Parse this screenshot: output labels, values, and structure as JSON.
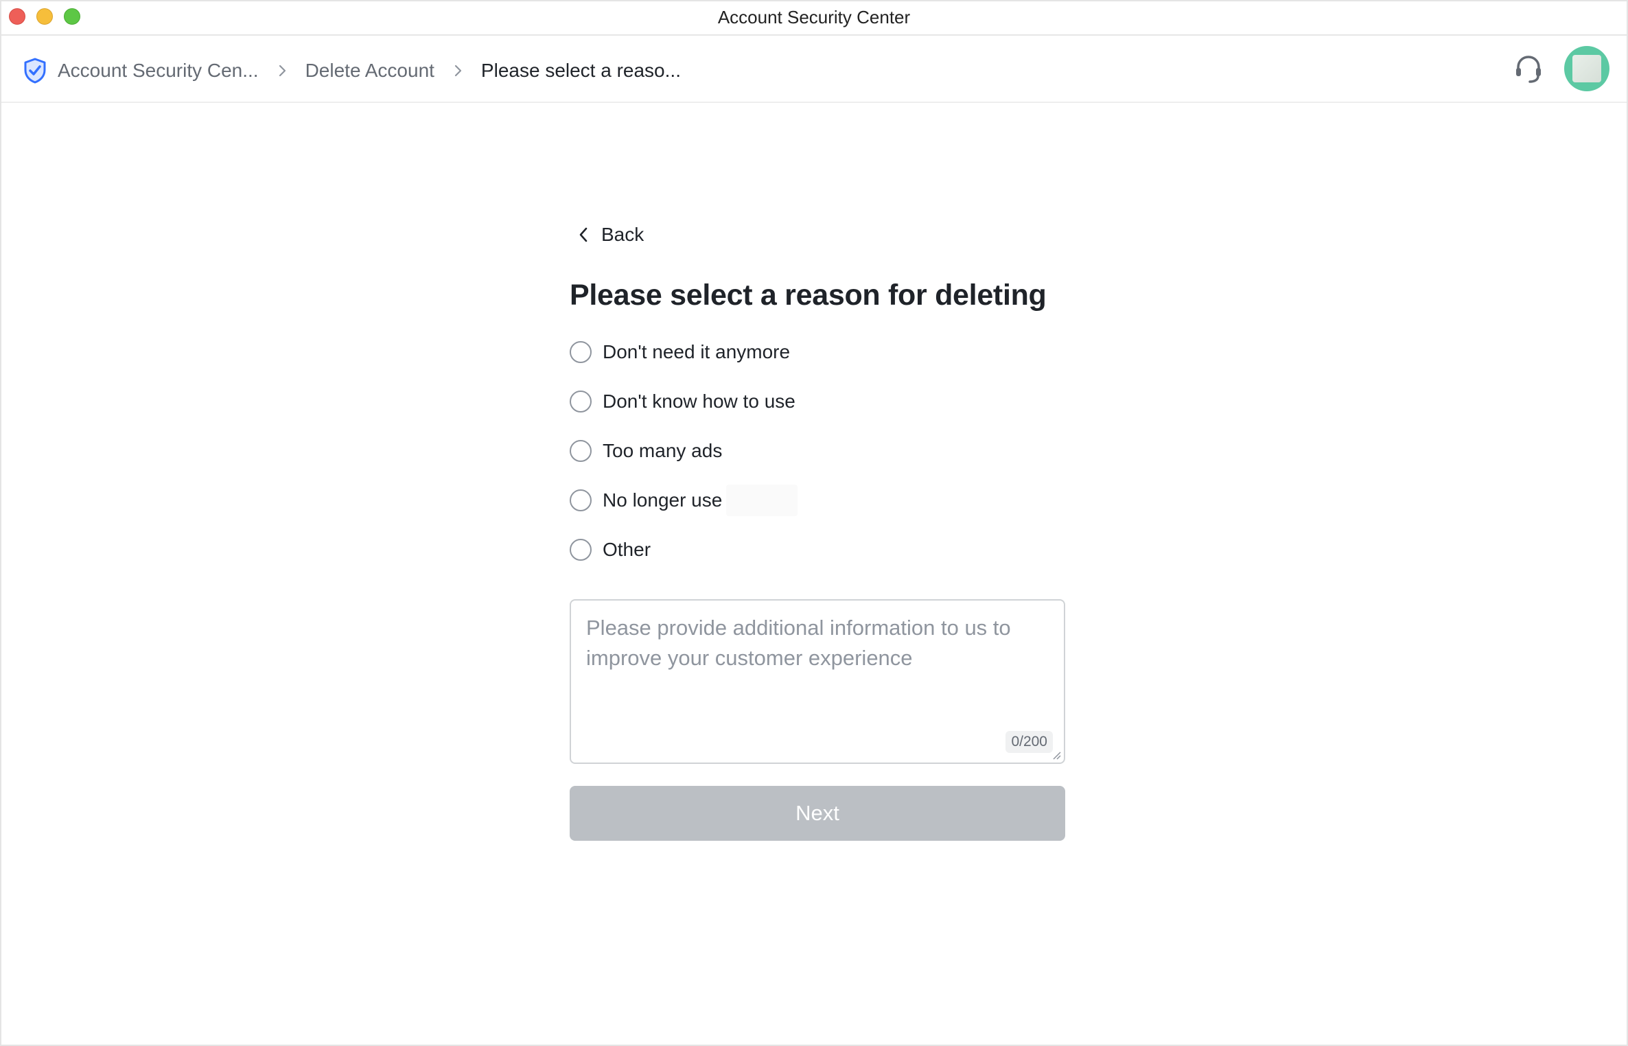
{
  "window": {
    "title": "Account Security Center"
  },
  "breadcrumb": {
    "items": [
      {
        "label": "Account Security Cen...",
        "icon": "shield-icon"
      },
      {
        "label": "Delete Account"
      },
      {
        "label": "Please select a reaso..."
      }
    ],
    "separator_icon": "chevron-right-icon"
  },
  "header": {
    "support_icon": "headset-icon",
    "avatar_color": "#5cc9a3"
  },
  "form": {
    "back_label": "Back",
    "title": "Please select a reason for deleting",
    "options": [
      {
        "label": "Don't need it anymore",
        "selected": false
      },
      {
        "label": "Don't know how to use",
        "selected": false
      },
      {
        "label": "Too many ads",
        "selected": false
      },
      {
        "label": "No longer use",
        "selected": false
      },
      {
        "label": "Other",
        "selected": false
      }
    ],
    "details_placeholder": "Please provide additional information to us to improve your customer experience",
    "details_value": "",
    "char_counter": "0/200",
    "next_label": "Next",
    "next_enabled": false
  },
  "colors": {
    "accent": "#3370ff",
    "button_disabled": "#bbbfc4",
    "text_primary": "#1f2329",
    "text_secondary": "#646a73"
  }
}
